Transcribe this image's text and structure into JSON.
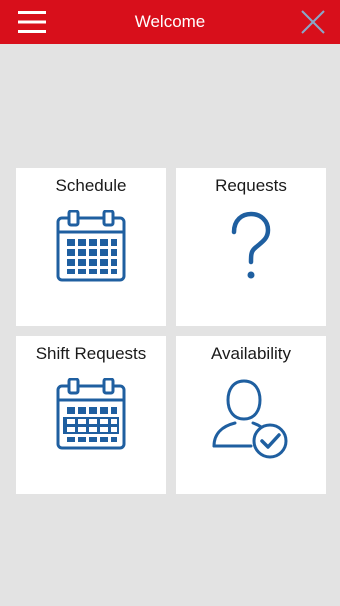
{
  "header": {
    "title": "Welcome",
    "background": "#d80f1b",
    "menu_icon": "hamburger-menu-icon",
    "close_icon": "close-icon"
  },
  "tiles": [
    {
      "label": "Schedule",
      "icon": "calendar-icon"
    },
    {
      "label": "Requests",
      "icon": "question-mark-icon"
    },
    {
      "label": "Shift Requests",
      "icon": "shift-calendar-icon"
    },
    {
      "label": "Availability",
      "icon": "user-check-icon"
    }
  ],
  "colors": {
    "accent": "#d80f1b",
    "icon_blue": "#1f5fa0",
    "background": "#e3e3e3",
    "tile": "#ffffff"
  }
}
